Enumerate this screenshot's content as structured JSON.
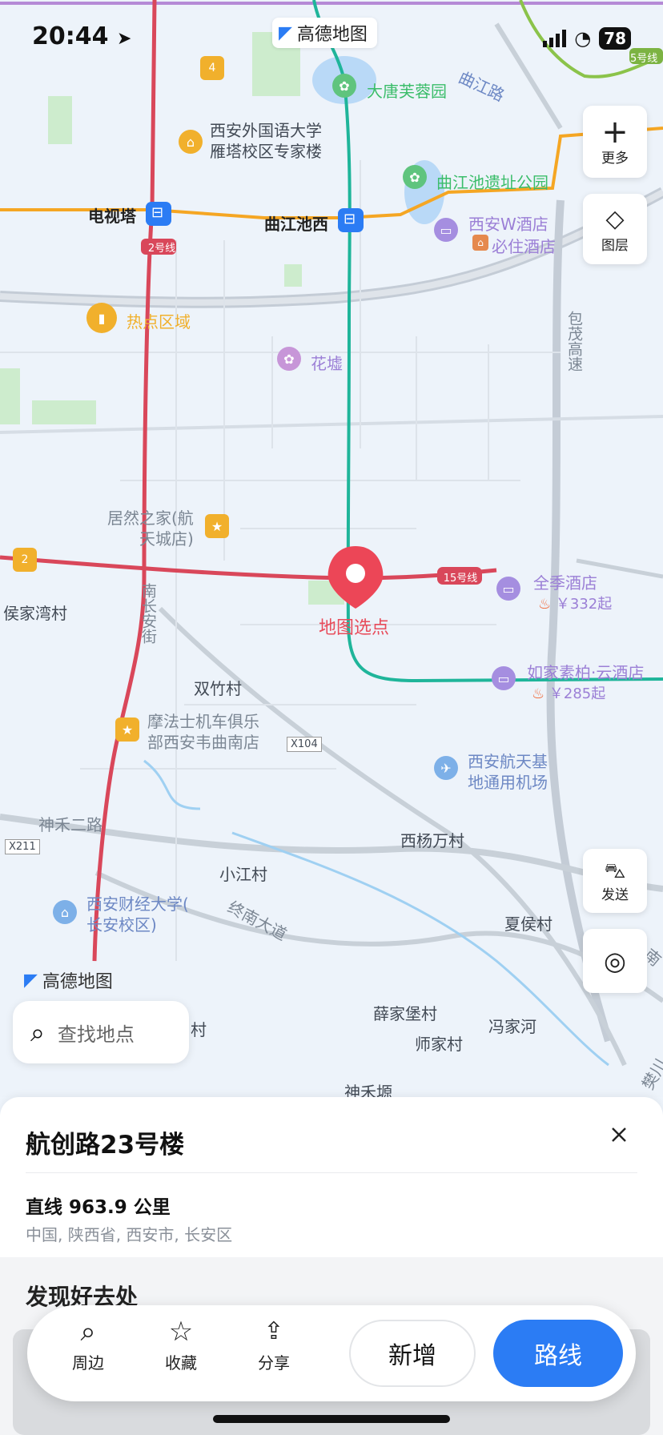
{
  "status_bar": {
    "time": "20:44",
    "battery": "78",
    "location_icon": "location-arrow-icon"
  },
  "map": {
    "top_badge": "高德地图",
    "bottom_badge": "高德地图",
    "labels": {
      "datang": "大唐芙蓉园",
      "xisu": "西安外国语大学\n雁塔校区专家楼",
      "qujiang_park": "曲江池遗址公园",
      "w_hotel": "西安W酒店",
      "bizhu": "必住酒店",
      "dianshita": "电视塔",
      "qujiangchixi": "曲江池西",
      "line2": "2号线",
      "line5": "5号线",
      "line15": "15号线",
      "hotspot": "热点区域",
      "huaxu": "花墟",
      "baomao": "包茂高速",
      "jurangzhijia": "居然之家(航\n天城店)",
      "houjiawan": "侯家湾村",
      "nanchangan": "南长安街",
      "selected": "地图选点",
      "quanji": "全季酒店",
      "quanji_price": "￥332起",
      "rujia": "如家素柏·云酒店",
      "rujia_price": "￥285起",
      "shuangzhu": "双竹村",
      "mofashi": "摩法士机车俱乐\n部西安韦曲南店",
      "x104": "X104",
      "airport": "西安航天基\n地通用机场",
      "shenhe": "神禾二路",
      "x211": "X211",
      "xiyangwan": "西杨万村",
      "xiaojiang": "小江村",
      "caijing": "西安财经大学(\n长安校区)",
      "jiaonan": "终南大道",
      "xiahou": "夏侯村",
      "xuejiabao": "薛家堡村",
      "shijia": "师家村",
      "fengjiahe": "冯家河",
      "shenheyuan": "神禾塬",
      "qujiang_road": "曲江路",
      "cun_partial": "村",
      "right_edge": "南",
      "right_edge2": "樊川",
      "star4": "4",
      "star2": "2"
    },
    "controls": {
      "more": "更多",
      "layers": "图层",
      "send": "发送"
    },
    "search_placeholder": "查找地点"
  },
  "sheet": {
    "title": "航创路23号楼",
    "distance": "直线 963.9 公里",
    "address": "中国, 陕西省, 西安市, 长安区",
    "discover": "发现好去处"
  },
  "bottom_bar": {
    "nearby": "周边",
    "favorite": "收藏",
    "share": "分享",
    "add": "新增",
    "route": "路线"
  },
  "colors": {
    "metro_red": "#d9475a",
    "metro_orange": "#f5a623",
    "metro_teal": "#1fb59a",
    "metro_green": "#8bc34a",
    "route_blue": "#2b7cf4",
    "pin_red": "#ec4657"
  }
}
